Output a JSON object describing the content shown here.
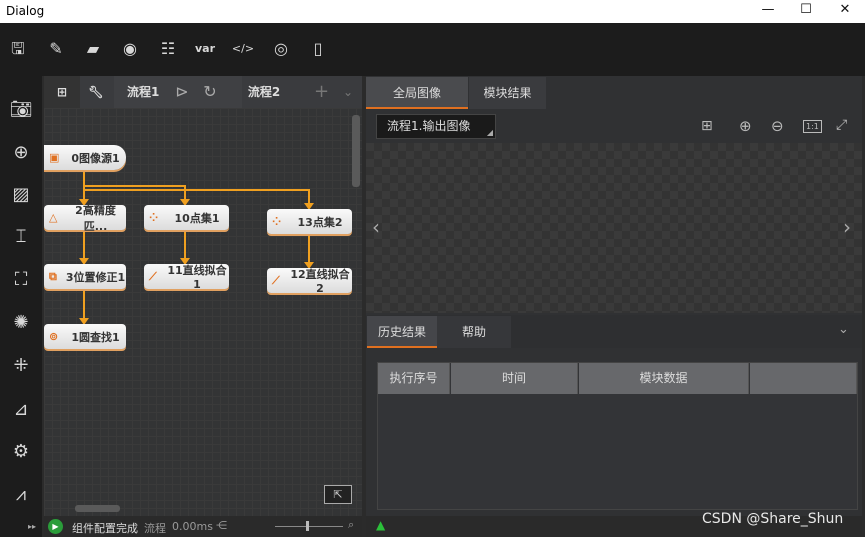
{
  "window": {
    "title": "Dialog",
    "minimize": "—",
    "maximize": "☐",
    "close": "✕"
  },
  "toolbar": [
    "save-icon",
    "save-as-icon",
    "open-folder-icon",
    "camera-icon",
    "controls-icon",
    "variable-icon",
    "script-icon",
    "record-icon",
    "device-icon"
  ],
  "toolbar_var_label": "var",
  "sidebar": [
    "camera-icon",
    "locate-icon",
    "image-edit-icon",
    "measure-icon",
    "roi-icon",
    "recognize-icon",
    "calibrate-icon",
    "compute-icon",
    "image-settings-icon",
    "histogram-icon"
  ],
  "flow": {
    "tabs": [
      {
        "label": "流程1"
      },
      {
        "label": "流程2"
      }
    ],
    "add": "+",
    "more": "⌄",
    "nodes": {
      "n0": "0图像源1",
      "n2": "2高精度匹...",
      "n10": "10点集1",
      "n13": "13点集2",
      "n3": "3位置修正1",
      "n11": "11直线拟合1",
      "n12": "12直线拟合2",
      "n1": "1圆查找1"
    }
  },
  "status": {
    "message": "组件配置完成",
    "flow_label": "流程",
    "time": "0.00ms"
  },
  "image_panel": {
    "tabs": [
      "全局图像",
      "模块结果"
    ],
    "source": "流程1.输出图像",
    "zoom_reset": "1:1"
  },
  "history": {
    "tabs": [
      "历史结果",
      "帮助"
    ],
    "columns": [
      "执行序号",
      "时间",
      "模块数据",
      ""
    ]
  },
  "watermark": "CSDN @Share_Shun",
  "colors": {
    "accent": "#f0a020",
    "tab_underline": "#e07020"
  }
}
